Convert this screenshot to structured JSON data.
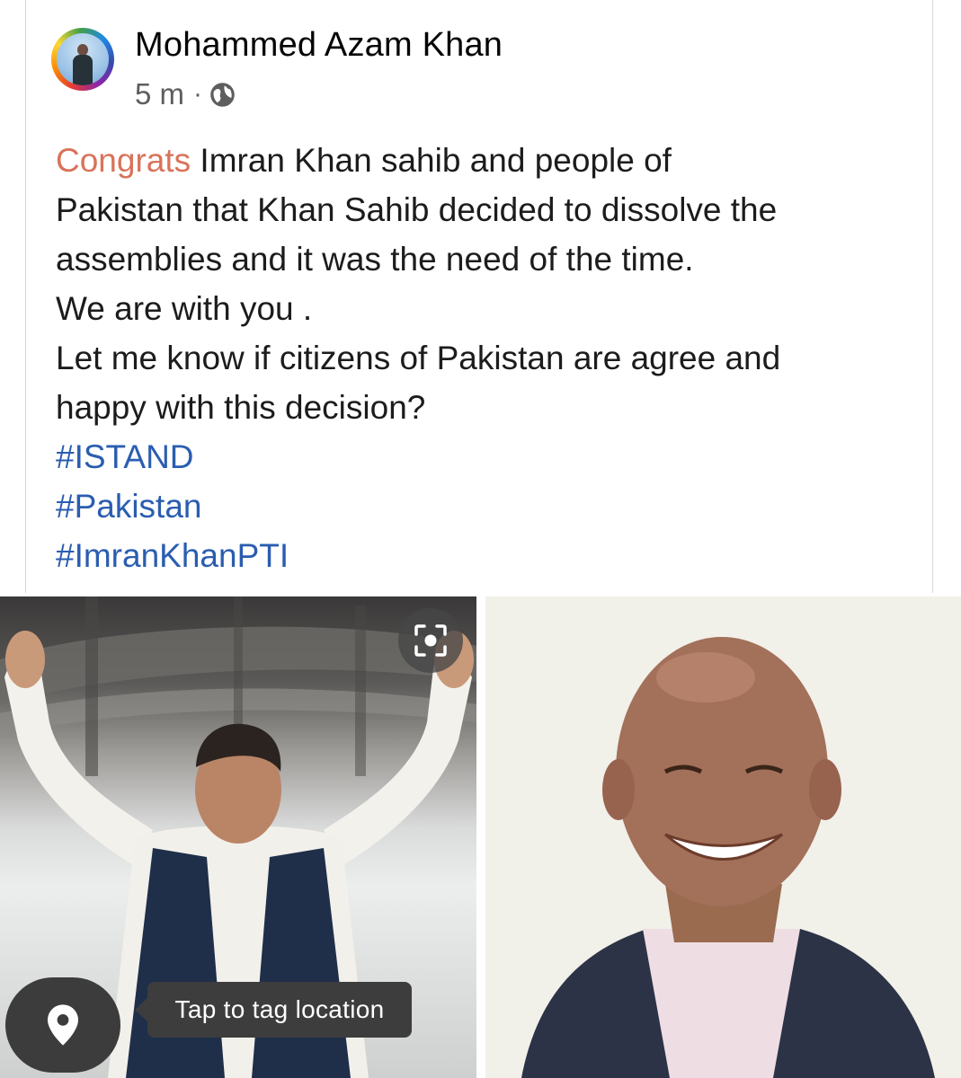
{
  "post": {
    "author": "Mohammed Azam Khan",
    "timestamp": "5 m",
    "separator": "·",
    "privacy_icon": "globe-icon",
    "congrats": "Congrats",
    "text_line_1": " Imran Khan sahib and people of",
    "text_line_2": "Pakistan that Khan Sahib decided to dissolve the",
    "text_line_3": "assemblies and it was the need of the time.",
    "text_line_4": "We are with you .",
    "text_line_5": "Let me know if citizens of Pakistan are agree and",
    "text_line_6": "happy with this decision?",
    "hashtags": [
      "#ISTAND",
      "#Pakistan",
      "#ImranKhanPTI"
    ]
  },
  "photos": {
    "left_icon": "scan-icon",
    "location_icon": "location-pin-icon",
    "tag_location_label": "Tap to tag location"
  },
  "colors": {
    "congrats": "#d9735a",
    "hashtag": "#2a5db0",
    "text": "#1c1c1c",
    "meta": "#5e5e5e"
  }
}
